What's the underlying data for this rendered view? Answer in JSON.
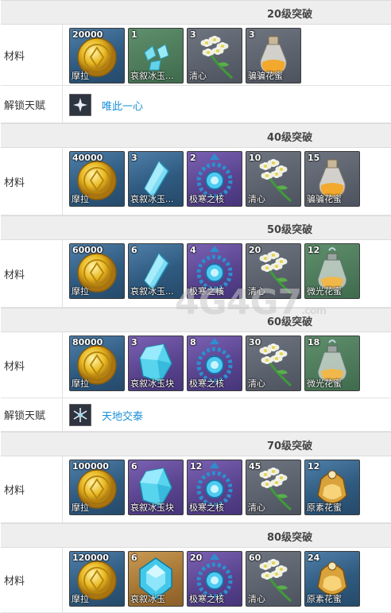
{
  "labels": {
    "materials": "材料",
    "unlock_talent": "解锁天赋"
  },
  "sections": [
    {
      "title": "20级突破",
      "items": [
        {
          "count": "20000",
          "name": "摩拉",
          "icon": "mora-coin-icon",
          "rarity": "r3"
        },
        {
          "count": "1",
          "name": "哀叙冰玉...",
          "icon": "ice-shard-icon",
          "rarity": "r2"
        },
        {
          "count": "3",
          "name": "清心",
          "icon": "qingxin-flower-icon",
          "rarity": "r1"
        },
        {
          "count": "3",
          "name": "骗骗花蜜",
          "icon": "nectar-bottle-icon",
          "rarity": "r1"
        }
      ],
      "talent": {
        "name": "唯此一心",
        "icon": "talent-star-icon"
      }
    },
    {
      "title": "40级突破",
      "items": [
        {
          "count": "40000",
          "name": "摩拉",
          "icon": "mora-coin-icon",
          "rarity": "r3"
        },
        {
          "count": "3",
          "name": "哀叙冰玉...",
          "icon": "ice-fragment-icon",
          "rarity": "r3"
        },
        {
          "count": "2",
          "name": "极寒之核",
          "icon": "cryo-core-icon",
          "rarity": "r4"
        },
        {
          "count": "10",
          "name": "清心",
          "icon": "qingxin-flower-icon",
          "rarity": "r1"
        },
        {
          "count": "15",
          "name": "骗骗花蜜",
          "icon": "nectar-bottle-icon",
          "rarity": "r1"
        }
      ]
    },
    {
      "title": "50级突破",
      "items": [
        {
          "count": "60000",
          "name": "摩拉",
          "icon": "mora-coin-icon",
          "rarity": "r3"
        },
        {
          "count": "6",
          "name": "哀叙冰玉...",
          "icon": "ice-fragment-icon",
          "rarity": "r3"
        },
        {
          "count": "4",
          "name": "极寒之核",
          "icon": "cryo-core-icon",
          "rarity": "r4"
        },
        {
          "count": "20",
          "name": "清心",
          "icon": "qingxin-flower-icon",
          "rarity": "r1"
        },
        {
          "count": "12",
          "name": "微光花蜜",
          "icon": "shimmering-nectar-icon",
          "rarity": "r2"
        }
      ]
    },
    {
      "title": "60级突破",
      "items": [
        {
          "count": "80000",
          "name": "摩拉",
          "icon": "mora-coin-icon",
          "rarity": "r3"
        },
        {
          "count": "3",
          "name": "哀叙冰玉块",
          "icon": "ice-chunk-icon",
          "rarity": "r4"
        },
        {
          "count": "8",
          "name": "极寒之核",
          "icon": "cryo-core-icon",
          "rarity": "r4"
        },
        {
          "count": "30",
          "name": "清心",
          "icon": "qingxin-flower-icon",
          "rarity": "r1"
        },
        {
          "count": "18",
          "name": "微光花蜜",
          "icon": "shimmering-nectar-icon",
          "rarity": "r2"
        }
      ],
      "talent": {
        "name": "天地交泰",
        "icon": "talent-snowflake-icon"
      }
    },
    {
      "title": "70级突破",
      "items": [
        {
          "count": "100000",
          "name": "摩拉",
          "icon": "mora-coin-icon",
          "rarity": "r3"
        },
        {
          "count": "6",
          "name": "哀叙冰玉块",
          "icon": "ice-chunk-icon",
          "rarity": "r4"
        },
        {
          "count": "12",
          "name": "极寒之核",
          "icon": "cryo-core-icon",
          "rarity": "r4"
        },
        {
          "count": "45",
          "name": "清心",
          "icon": "qingxin-flower-icon",
          "rarity": "r1"
        },
        {
          "count": "12",
          "name": "原素花蜜",
          "icon": "energy-nectar-icon",
          "rarity": "r3"
        }
      ]
    },
    {
      "title": "80级突破",
      "items": [
        {
          "count": "120000",
          "name": "摩拉",
          "icon": "mora-coin-icon",
          "rarity": "r3"
        },
        {
          "count": "6",
          "name": "哀叙冰玉",
          "icon": "ice-gemstone-icon",
          "rarity": "r5"
        },
        {
          "count": "20",
          "name": "极寒之核",
          "icon": "cryo-core-icon",
          "rarity": "r4"
        },
        {
          "count": "60",
          "name": "清心",
          "icon": "qingxin-flower-icon",
          "rarity": "r1"
        },
        {
          "count": "24",
          "name": "原素花蜜",
          "icon": "energy-nectar-icon",
          "rarity": "r3"
        }
      ]
    }
  ],
  "watermark": {
    "main": "4G4G7",
    "suffix": ".com"
  }
}
